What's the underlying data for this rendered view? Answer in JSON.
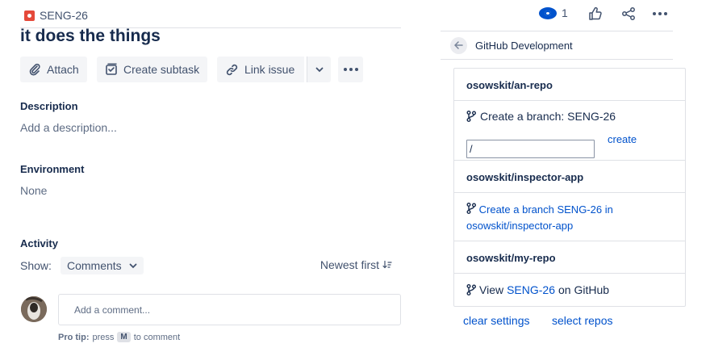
{
  "issue": {
    "key": "SENG-26",
    "title": "it does the things"
  },
  "toolbar": {
    "attach_label": "Attach",
    "subtask_label": "Create subtask",
    "link_label": "Link issue"
  },
  "description": {
    "label": "Description",
    "placeholder": "Add a description..."
  },
  "environment": {
    "label": "Environment",
    "value": "None"
  },
  "activity": {
    "label": "Activity",
    "show_label": "Show:",
    "show_value": "Comments",
    "sort_label": "Newest first",
    "comment_placeholder": "Add a comment...",
    "protip_bold": "Pro tip:",
    "protip_press": "press",
    "protip_key": "M",
    "protip_rest": "to comment"
  },
  "header": {
    "watch_count": "1"
  },
  "github_panel": {
    "title": "GitHub Development",
    "repos": [
      {
        "name": "osowskit/an-repo",
        "create_branch_text": "Create a branch: SENG-26",
        "branch_input_value": "/",
        "create_link": "create"
      },
      {
        "name": "osowskit/inspector-app",
        "create_branch_link": "Create a branch SENG-26 in osowskit/inspector-app"
      },
      {
        "name": "osowskit/my-repo",
        "view_prefix": "View",
        "view_link": "SENG-26",
        "view_suffix": "on GitHub"
      }
    ],
    "clear_settings": "clear settings",
    "select_repos": "select repos"
  },
  "colors": {
    "link": "#0052cc",
    "bug": "#e5493a",
    "text": "#172b4d",
    "muted": "#5e6c84"
  }
}
